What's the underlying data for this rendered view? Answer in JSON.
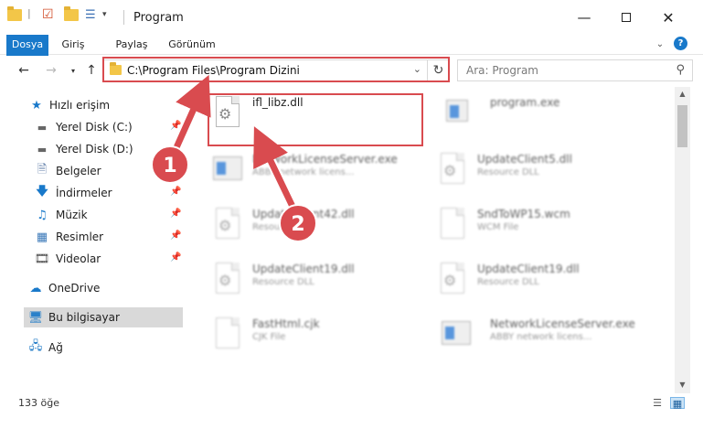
{
  "window": {
    "title": "Program"
  },
  "ribbon": {
    "tabs": [
      "Dosya",
      "Giriş",
      "Paylaş",
      "Görünüm"
    ]
  },
  "address": {
    "path": "C:\\Program Files\\Program Dizini"
  },
  "search": {
    "placeholder": "Ara: Program"
  },
  "sidebar": {
    "items": [
      {
        "label": "Hızlı erişim",
        "icon": "star-icon"
      },
      {
        "label": "Yerel Disk (C:)",
        "icon": "drive-icon",
        "pinned": true
      },
      {
        "label": "Yerel Disk (D:)",
        "icon": "drive-icon"
      },
      {
        "label": "Belgeler",
        "icon": "documents-icon",
        "pinned": true
      },
      {
        "label": "İndirmeler",
        "icon": "downloads-icon",
        "pinned": true
      },
      {
        "label": "Müzik",
        "icon": "music-icon",
        "pinned": true
      },
      {
        "label": "Resimler",
        "icon": "pictures-icon",
        "pinned": true
      },
      {
        "label": "Videolar",
        "icon": "videos-icon",
        "pinned": true
      },
      {
        "label": "OneDrive",
        "icon": "cloud-icon"
      },
      {
        "label": "Bu bilgisayar",
        "icon": "computer-icon",
        "selected": true
      },
      {
        "label": "Ağ",
        "icon": "network-icon"
      }
    ]
  },
  "files": [
    {
      "name": "ifl_libz.dll",
      "desc": "",
      "icon": "dll-gear-icon",
      "highlighted": true
    },
    {
      "name": "program.exe",
      "desc": "",
      "icon": "exe-icon"
    },
    {
      "name": "NetworkLicenseServer.exe",
      "desc": "ABBY network licens...",
      "icon": "app-icon"
    },
    {
      "name": "UpdateClient5.dll",
      "desc": "Resource DLL",
      "icon": "dll-gear-icon"
    },
    {
      "name": "UpdateClient42.dll",
      "desc": "Resource DLL",
      "icon": "dll-gear-icon"
    },
    {
      "name": "SndToWP15.wcm",
      "desc": "WCM File",
      "icon": "file-icon"
    },
    {
      "name": "UpdateClient19.dll",
      "desc": "Resource DLL",
      "icon": "dll-gear-icon"
    },
    {
      "name": "UpdateClient19.dll",
      "desc": "Resource DLL",
      "icon": "dll-gear-icon"
    },
    {
      "name": "FastHtml.cjk",
      "desc": "CJK File",
      "icon": "file-icon"
    },
    {
      "name": "NetworkLicenseServer.exe",
      "desc": "ABBY network licens...",
      "icon": "app-icon"
    }
  ],
  "annotations": {
    "step1": "1",
    "step2": "2"
  },
  "status": {
    "item_count": "133 öğe"
  },
  "colors": {
    "accent": "#1979ca",
    "annotation": "#d94b4f",
    "selection": "#d9d9d9"
  }
}
